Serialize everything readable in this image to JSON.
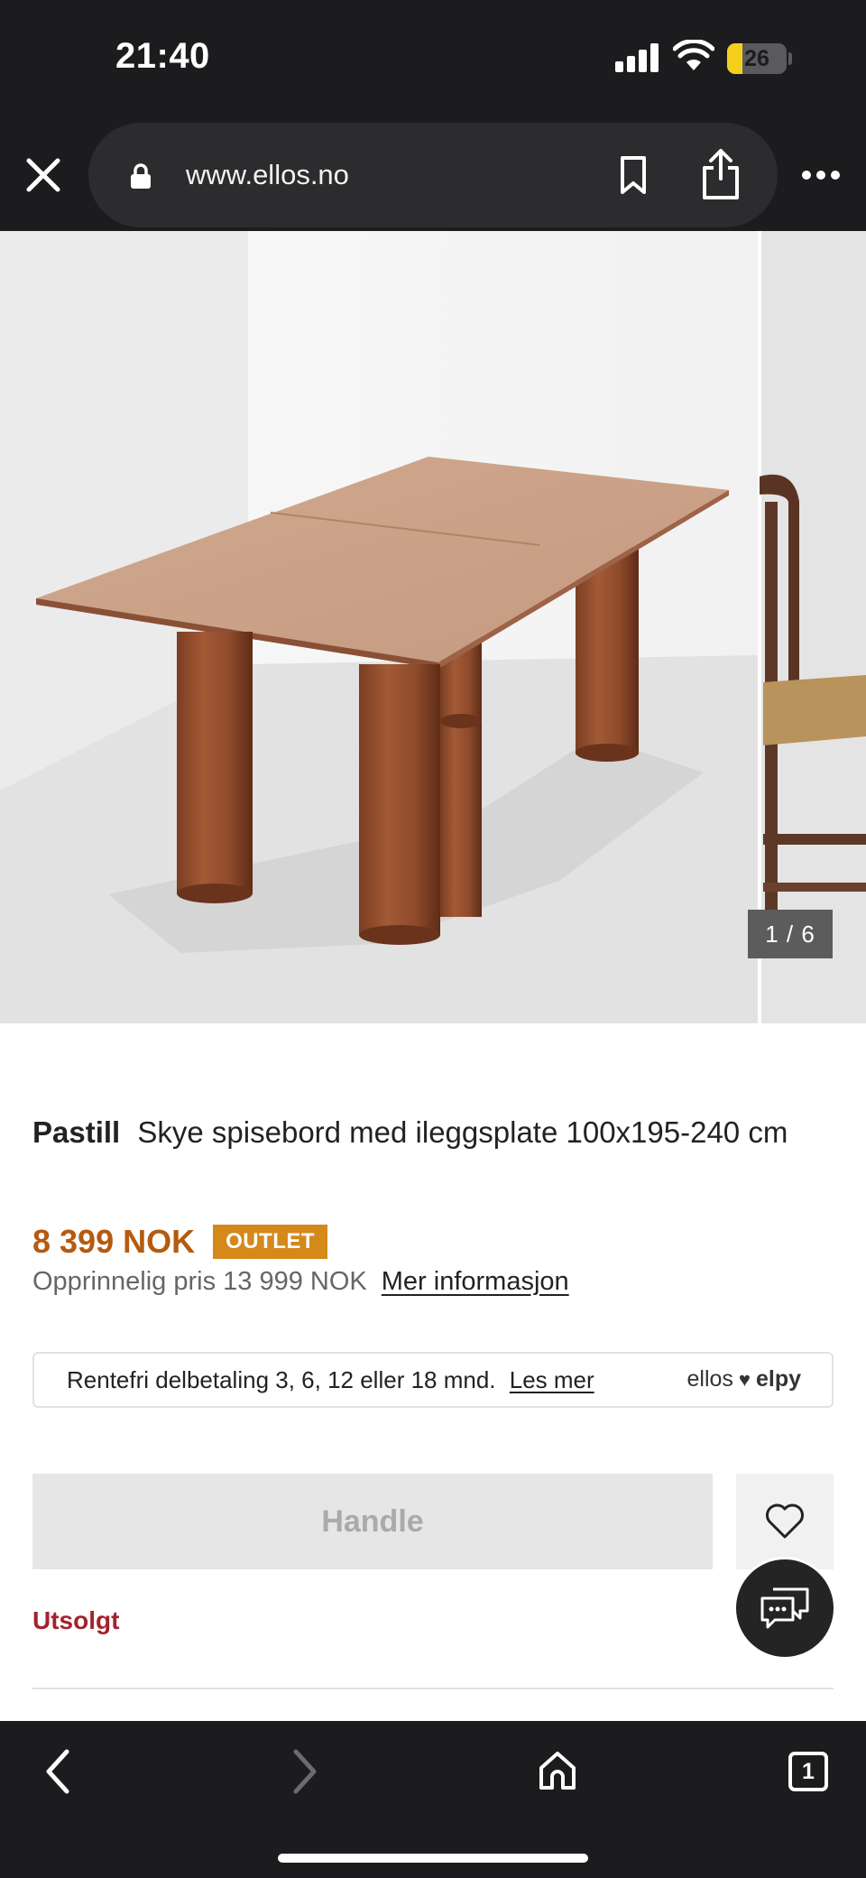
{
  "status_bar": {
    "time": "21:40",
    "battery_percent": "26",
    "battery_level": 0.26
  },
  "browser": {
    "url": "www.ellos.no",
    "close_icon": "close-icon",
    "lock_icon": "lock-icon",
    "bookmark_icon": "bookmark-icon",
    "share_icon": "share-icon",
    "more_icon": "more-icon"
  },
  "gallery": {
    "counter": "1 / 6",
    "current": 1,
    "total": 6
  },
  "product": {
    "brand": "Pastill",
    "name": "Skye spisebord med ileggsplate 100x195-240 cm",
    "price": "8 399 NOK",
    "badge": "OUTLET",
    "original_price": "Opprinnelig pris 13 999 NOK",
    "more_info_link": "Mer informasjon"
  },
  "financing": {
    "text": "Rentefri delbetaling 3, 6, 12 eller 18 mnd.",
    "link": "Les mer",
    "logo_left": "ellos",
    "logo_right": "elpy"
  },
  "actions": {
    "buy_label": "Handle",
    "sold_out": "Utsolgt"
  },
  "colors": {
    "price": "#b55a0f",
    "badge": "#d4891a",
    "sold_out": "#a3222d",
    "bar_background": "#1c1c1e"
  },
  "bottom_bar": {
    "tab_count": "1"
  }
}
